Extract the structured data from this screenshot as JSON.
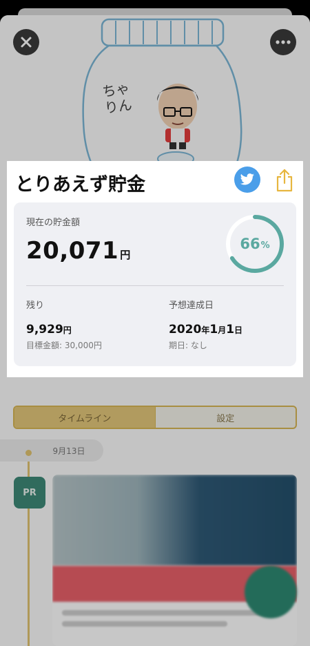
{
  "nav": {
    "close_icon": "close-icon",
    "more_icon": "more-icon"
  },
  "hero": {
    "jar_text": "ちゃりん"
  },
  "card": {
    "title": "とりあえず貯金",
    "twitter_icon": "twitter-icon",
    "share_icon": "share-icon",
    "current_label": "現在の貯金額",
    "current_amount": "20,071",
    "current_unit": "円",
    "progress_percent": "66",
    "progress_percent_unit": "%",
    "progress_value": 0.66,
    "remaining_label": "残り",
    "remaining_amount": "9,929",
    "remaining_unit": "円",
    "target_text": "目標金額: 30,000円",
    "forecast_label": "予想達成日",
    "forecast_year": "2020",
    "forecast_year_unit": "年",
    "forecast_month": "1",
    "forecast_month_unit": "月",
    "forecast_day": "1",
    "forecast_day_unit": "日",
    "deadline_text": "期日: なし"
  },
  "tabs": [
    {
      "label": "タイムライン",
      "active": true
    },
    {
      "label": "設定",
      "active": false
    }
  ],
  "timeline": {
    "date": "9月13日",
    "badge": "PR"
  },
  "colors": {
    "accent": "#e1c370",
    "progress": "#5aa8a0",
    "twitter": "#4a9ee9",
    "share": "#e7b63f",
    "badge": "#3e8a78"
  }
}
